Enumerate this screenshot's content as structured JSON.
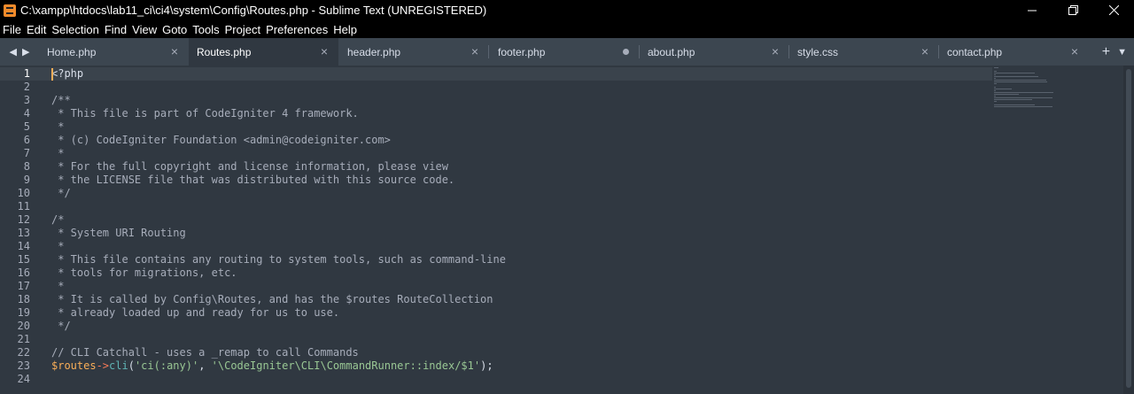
{
  "window": {
    "title": "C:\\xampp\\htdocs\\lab11_ci\\ci4\\system\\Config\\Routes.php - Sublime Text (UNREGISTERED)"
  },
  "menu": [
    "File",
    "Edit",
    "Selection",
    "Find",
    "View",
    "Goto",
    "Tools",
    "Project",
    "Preferences",
    "Help"
  ],
  "tabs": [
    {
      "label": "Home.php",
      "state": "close"
    },
    {
      "label": "Routes.php",
      "state": "active"
    },
    {
      "label": "header.php",
      "state": "close"
    },
    {
      "label": "footer.php",
      "state": "dirty"
    },
    {
      "label": "about.php",
      "state": "close"
    },
    {
      "label": "style.css",
      "state": "close"
    },
    {
      "label": "contact.php",
      "state": "close"
    }
  ],
  "editor": {
    "current_line": 1,
    "line_numbers": [
      "1",
      "2",
      "3",
      "4",
      "5",
      "6",
      "7",
      "8",
      "9",
      "10",
      "11",
      "12",
      "13",
      "14",
      "15",
      "16",
      "17",
      "18",
      "19",
      "20",
      "21",
      "22",
      "23",
      "24"
    ],
    "lines": [
      "<?php",
      "",
      "/**",
      " * This file is part of CodeIgniter 4 framework.",
      " *",
      " * (c) CodeIgniter Foundation <admin@codeigniter.com>",
      " *",
      " * For the full copyright and license information, please view",
      " * the LICENSE file that was distributed with this source code.",
      " */",
      "",
      "/*",
      " * System URI Routing",
      " *",
      " * This file contains any routing to system tools, such as command-line",
      " * tools for migrations, etc.",
      " *",
      " * It is called by Config\\Routes, and has the $routes RouteCollection",
      " * already loaded up and ready for us to use.",
      " */",
      "",
      "// CLI Catchall - uses a _remap to call Commands",
      "$routes->cli('ci(:any)', '\\CodeIgniter\\CLI\\CommandRunner::index/$1');",
      ""
    ]
  },
  "colors": {
    "background": "#303841",
    "comment": "#a7adba",
    "variable": "#f9ae58",
    "operator": "#f97b58",
    "function": "#5fb4b4",
    "string": "#99c794"
  }
}
